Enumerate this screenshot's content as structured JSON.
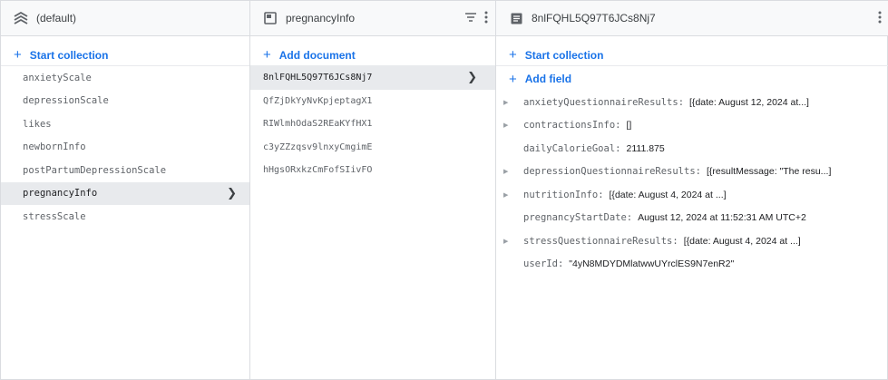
{
  "columns": {
    "database": {
      "header": "(default)",
      "action": "Start collection",
      "items": [
        "anxietyScale",
        "depressionScale",
        "likes",
        "newbornInfo",
        "postPartumDepressionScale",
        "pregnancyInfo",
        "stressScale"
      ],
      "selected_index": 5
    },
    "collection": {
      "header": "pregnancyInfo",
      "action": "Add document",
      "items": [
        "8nlFQHL5Q97T6JCs8Nj7",
        "QfZjDkYyNvKpjeptagX1",
        "RIWlmhOdaS2REaKYfHX1",
        "c3yZZzqsv9lnxyCmgimE",
        "hHgsORxkzCmFofSIivFO"
      ],
      "selected_index": 0
    },
    "document": {
      "header": "8nlFQHL5Q97T6JCs8Nj7",
      "action_start": "Start collection",
      "action_add": "Add field",
      "fields": [
        {
          "name": "anxietyQuestionnaireResults",
          "value": "[{date: August 12, 2024 at...]",
          "expandable": true
        },
        {
          "name": "contractionsInfo",
          "value": "[]",
          "expandable": true
        },
        {
          "name": "dailyCalorieGoal",
          "value": "2111.875",
          "expandable": false
        },
        {
          "name": "depressionQuestionnaireResults",
          "value": "[{resultMessage: \"The resu...]",
          "expandable": true
        },
        {
          "name": "nutritionInfo",
          "value": "[{date: August 4, 2024 at ...]",
          "expandable": true
        },
        {
          "name": "pregnancyStartDate",
          "value": "August 12, 2024 at 11:52:31 AM UTC+2",
          "expandable": false
        },
        {
          "name": "stressQuestionnaireResults",
          "value": "[{date: August 4, 2024 at ...]",
          "expandable": true
        },
        {
          "name": "userId",
          "value": "\"4yN8MDYDMlatwwUYrclES9N7enR2\"",
          "expandable": false
        }
      ]
    }
  },
  "icons": {
    "database": "database-icon",
    "collection": "collection-icon",
    "document": "document-icon",
    "filter": "filter-icon",
    "more": "more-vert-icon",
    "chevron": "chevron-right-icon",
    "expand": "expand-triangle-icon"
  },
  "colors": {
    "accent": "#1a73e8",
    "selected_bg": "#e8eaed",
    "header_bg": "#f8f9fa",
    "border": "#dadce0"
  }
}
